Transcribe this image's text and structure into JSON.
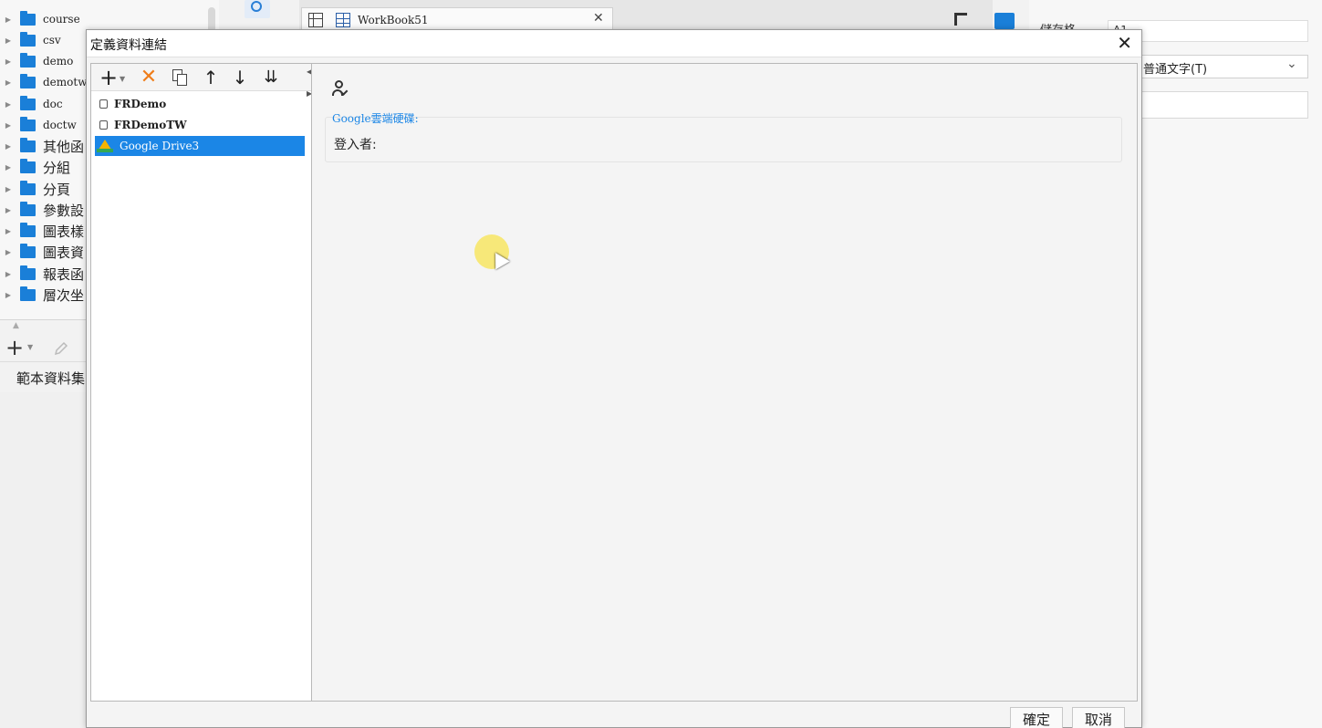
{
  "file_tree": {
    "items": [
      {
        "label": "course"
      },
      {
        "label": "csv"
      },
      {
        "label": "demo"
      },
      {
        "label": "demotw"
      },
      {
        "label": "doc"
      },
      {
        "label": "doctw"
      },
      {
        "label": "其他函"
      },
      {
        "label": "分組"
      },
      {
        "label": "分頁"
      },
      {
        "label": "參數設"
      },
      {
        "label": "圖表樣"
      },
      {
        "label": "圖表資"
      },
      {
        "label": "報表函"
      },
      {
        "label": "層次坐"
      }
    ]
  },
  "dataset_panel": {
    "title": "範本資料集"
  },
  "workbook_tab": {
    "label": "WorkBook51"
  },
  "property_panel": {
    "cell_label": "儲存格",
    "cell_value": "A1",
    "type_select": "普通文字(T)"
  },
  "dialog": {
    "title": "定義資料連結",
    "toolbar": {
      "add": "+",
      "delete": "✕",
      "up": "↑",
      "down": "↓",
      "sort": "⇊"
    },
    "connections": [
      {
        "label": "FRDemo",
        "icon": "database-icon"
      },
      {
        "label": "FRDemoTW",
        "icon": "database-icon"
      },
      {
        "label": "Google Drive3",
        "icon": "google-drive-icon"
      }
    ],
    "detail": {
      "section_title": "Google雲端硬碟:",
      "login_label": "登入者:"
    },
    "ok_label": "確定",
    "cancel_label": "取消"
  },
  "colors": {
    "accent": "#1b86e6",
    "delete": "#ef7d1a",
    "folder": "#1a7fd8"
  }
}
